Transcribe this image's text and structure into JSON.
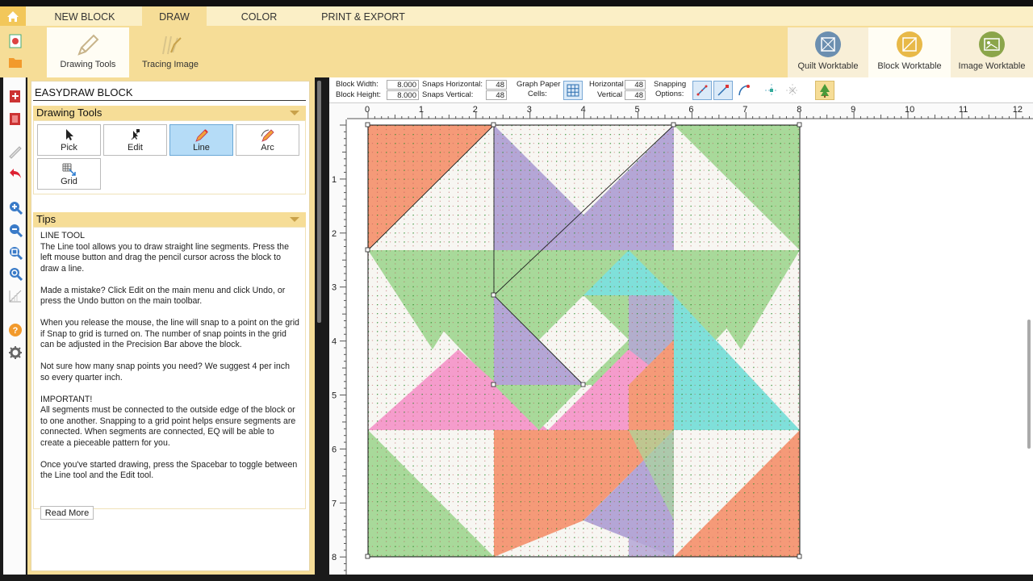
{
  "tabs": [
    {
      "label": "NEW BLOCK",
      "active": false
    },
    {
      "label": "DRAW",
      "active": true
    },
    {
      "label": "COLOR",
      "active": false
    },
    {
      "label": "PRINT & EXPORT",
      "active": false
    }
  ],
  "ribbon": {
    "drawing_tools": "Drawing Tools",
    "tracing_image": "Tracing Image"
  },
  "worktables": {
    "quilt": "Quilt Worktable",
    "block": "Block Worktable",
    "image": "Image Worktable"
  },
  "panel": {
    "title": "EASYDRAW BLOCK",
    "drawing_tools_header": "Drawing Tools",
    "tools": [
      "Pick",
      "Edit",
      "Line",
      "Arc",
      "Grid"
    ],
    "selected_tool": "Line",
    "tips_header": "Tips",
    "tips": [
      "LINE TOOL\nThe Line tool allows you to draw straight line segments. Press the left mouse button and drag the pencil cursor across the block to draw a line.",
      "Made a mistake? Click Edit on the main menu and click Undo, or press the Undo button on the main toolbar.",
      "When you release the mouse, the line will snap to a point on the grid if Snap to grid is turned on. The number of snap points in the grid can be adjusted in the Precision Bar above the block.",
      "Not sure how many snap points you need? We suggest 4 per inch so every quarter inch.",
      "IMPORTANT!\nAll segments must be connected to the outside edge of the block or to one another. Snapping to a grid point helps ensure segments are connected. When segments are connected, EQ will be able to create a pieceable pattern for you.",
      "Once you've started drawing, press the Spacebar to toggle between the Line tool and the Edit tool."
    ],
    "read_more": "Read More"
  },
  "precision": {
    "block_width_label": "Block Width:",
    "block_width": "8.000",
    "block_height_label": "Block Height:",
    "block_height": "8.000",
    "snaps_h_label": "Snaps Horizontal:",
    "snaps_h": "48",
    "snaps_v_label": "Snaps Vertical:",
    "snaps_v": "48",
    "graph_paper_label": "Graph Paper",
    "cells_label": "Cells:",
    "horizontal_label": "Horizontal",
    "horizontal": "48",
    "vertical_label": "Vertical",
    "vertical": "48",
    "snapping_label": "Snapping",
    "options_label": "Options:"
  },
  "ruler": {
    "h_ticks": [
      "0",
      "1",
      "2",
      "3",
      "4",
      "5",
      "6",
      "7",
      "8",
      "9",
      "10",
      "11",
      "12"
    ],
    "v_ticks": [
      "1",
      "2",
      "3",
      "4",
      "5",
      "6",
      "7",
      "8"
    ]
  },
  "colors": {
    "orange": "#f59a78",
    "purple": "#b4a6d6",
    "green": "#a8d99a",
    "pink": "#f59ccc",
    "teal": "#7fe0da",
    "white": "#f7f6f2",
    "accent": "#f6dd97"
  }
}
